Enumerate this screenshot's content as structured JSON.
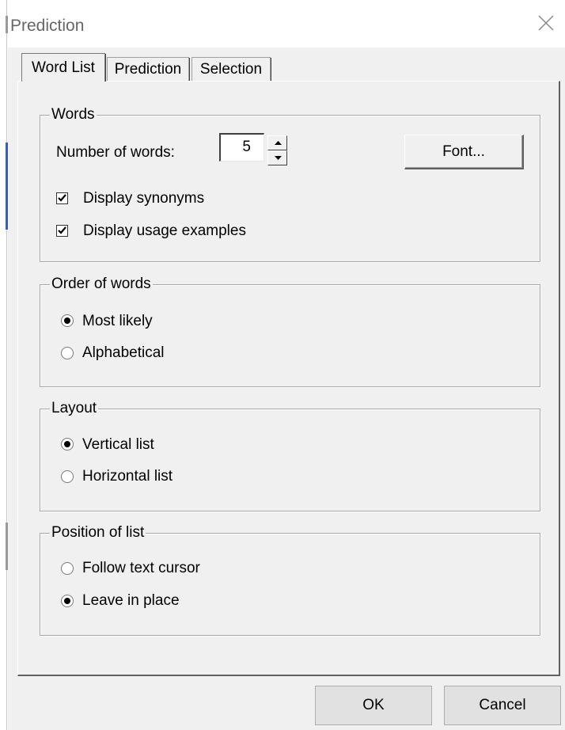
{
  "window": {
    "title": "Prediction"
  },
  "tabs": [
    {
      "label": "Word List",
      "active": true
    },
    {
      "label": "Prediction",
      "active": false
    },
    {
      "label": "Selection",
      "active": false
    }
  ],
  "words_group": {
    "legend": "Words",
    "number_label": "Number of words:",
    "number_value": "5",
    "font_button": "Font...",
    "display_synonyms": {
      "label": "Display synonyms",
      "checked": true
    },
    "display_usage": {
      "label": "Display usage examples",
      "checked": true
    }
  },
  "order_group": {
    "legend": "Order of words",
    "options": [
      {
        "label": "Most likely",
        "selected": true
      },
      {
        "label": "Alphabetical",
        "selected": false
      }
    ]
  },
  "layout_group": {
    "legend": "Layout",
    "options": [
      {
        "label": "Vertical list",
        "selected": true
      },
      {
        "label": "Horizontal list",
        "selected": false
      }
    ]
  },
  "position_group": {
    "legend": "Position of list",
    "options": [
      {
        "label": "Follow text cursor",
        "selected": false
      },
      {
        "label": "Leave in place",
        "selected": true
      }
    ]
  },
  "footer": {
    "ok": "OK",
    "cancel": "Cancel"
  },
  "icons": {
    "close": "close-icon",
    "spin_up": "arrow-up-icon",
    "spin_down": "arrow-down-icon",
    "check": "checkmark-icon"
  }
}
